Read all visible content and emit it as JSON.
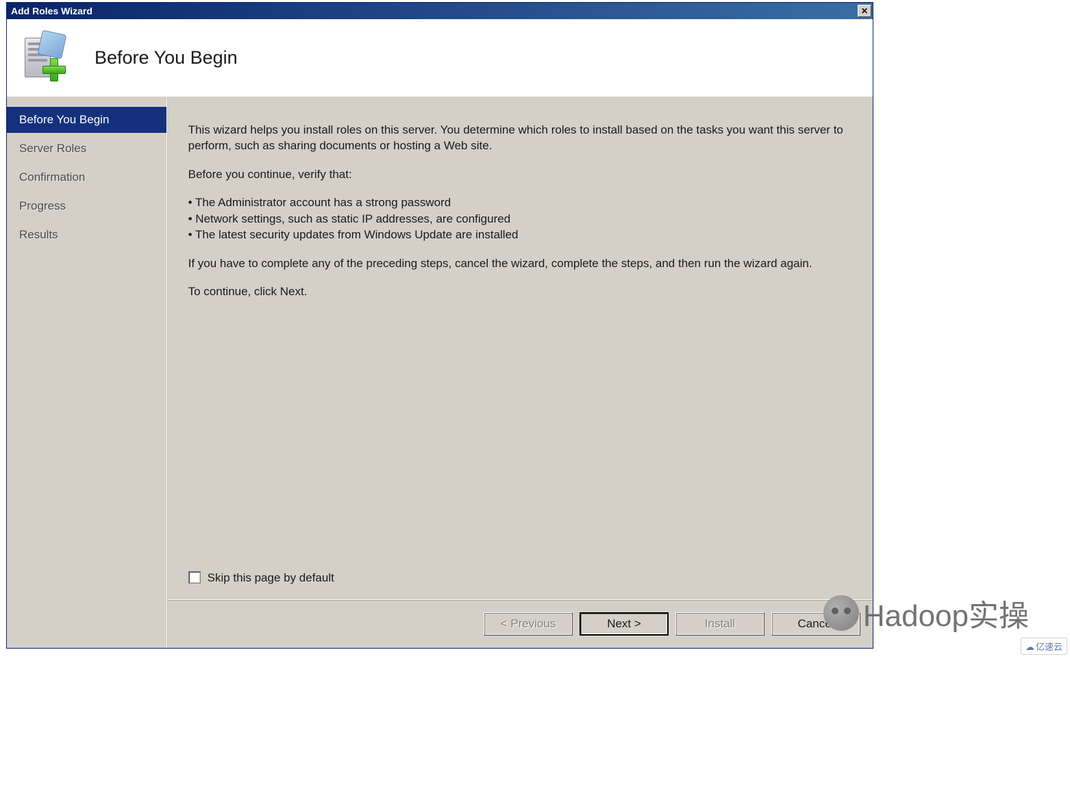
{
  "window": {
    "title": "Add Roles Wizard"
  },
  "header": {
    "page_title": "Before You Begin"
  },
  "sidebar": {
    "items": [
      {
        "label": "Before You Begin",
        "selected": true
      },
      {
        "label": "Server Roles",
        "selected": false
      },
      {
        "label": "Confirmation",
        "selected": false
      },
      {
        "label": "Progress",
        "selected": false
      },
      {
        "label": "Results",
        "selected": false
      }
    ]
  },
  "content": {
    "intro": "This wizard helps you install roles on this server. You determine which roles to install based on the tasks you want this server to perform, such as sharing documents or hosting a Web site.",
    "verify_lead": "Before you continue, verify that:",
    "bullets": [
      "The Administrator account has a strong password",
      "Network settings, such as static IP addresses, are configured",
      "The latest security updates from Windows Update are installed"
    ],
    "post_bullets": "If you have to complete any of the preceding steps, cancel the wizard, complete the steps, and then run the wizard again.",
    "continue_hint": "To continue, click Next.",
    "skip_label": "Skip this page by default",
    "skip_checked": false
  },
  "buttons": {
    "previous": "< Previous",
    "next": "Next >",
    "install": "Install",
    "cancel": "Cancel",
    "previous_enabled": false,
    "next_enabled": true,
    "install_enabled": false,
    "cancel_enabled": true
  },
  "watermark": {
    "text": "Hadoop实操",
    "corner": "亿速云"
  }
}
